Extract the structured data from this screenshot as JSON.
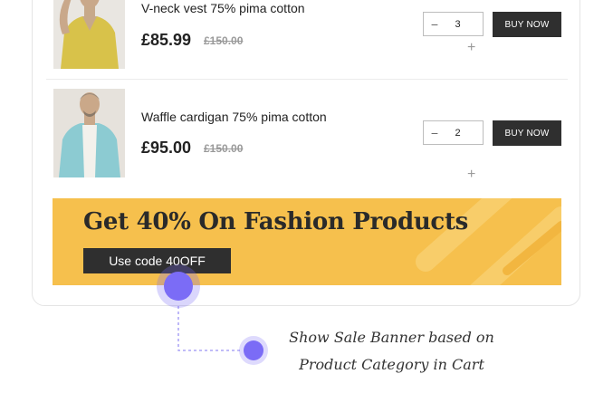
{
  "products": [
    {
      "name": "V-neck vest 75% pima cotton",
      "price": "£85.99",
      "original_price": "£150.00",
      "quantity": "3",
      "buy_label": "BUY NOW",
      "minus_symbol": "−",
      "plus_symbol": "+"
    },
    {
      "name": "Waffle cardigan 75% pima cotton",
      "price": "£95.00",
      "original_price": "£150.00",
      "quantity": "2",
      "buy_label": "BUY NOW",
      "minus_symbol": "−",
      "plus_symbol": "+"
    }
  ],
  "banner": {
    "title": "Get 40% On Fashion Products",
    "code_label": "Use code 40OFF",
    "background_color": "#f6c04d"
  },
  "annotation": {
    "line1": "Show Sale Banner based on",
    "line2": "Product Category in Cart",
    "accent_color": "#7b6cf6"
  }
}
